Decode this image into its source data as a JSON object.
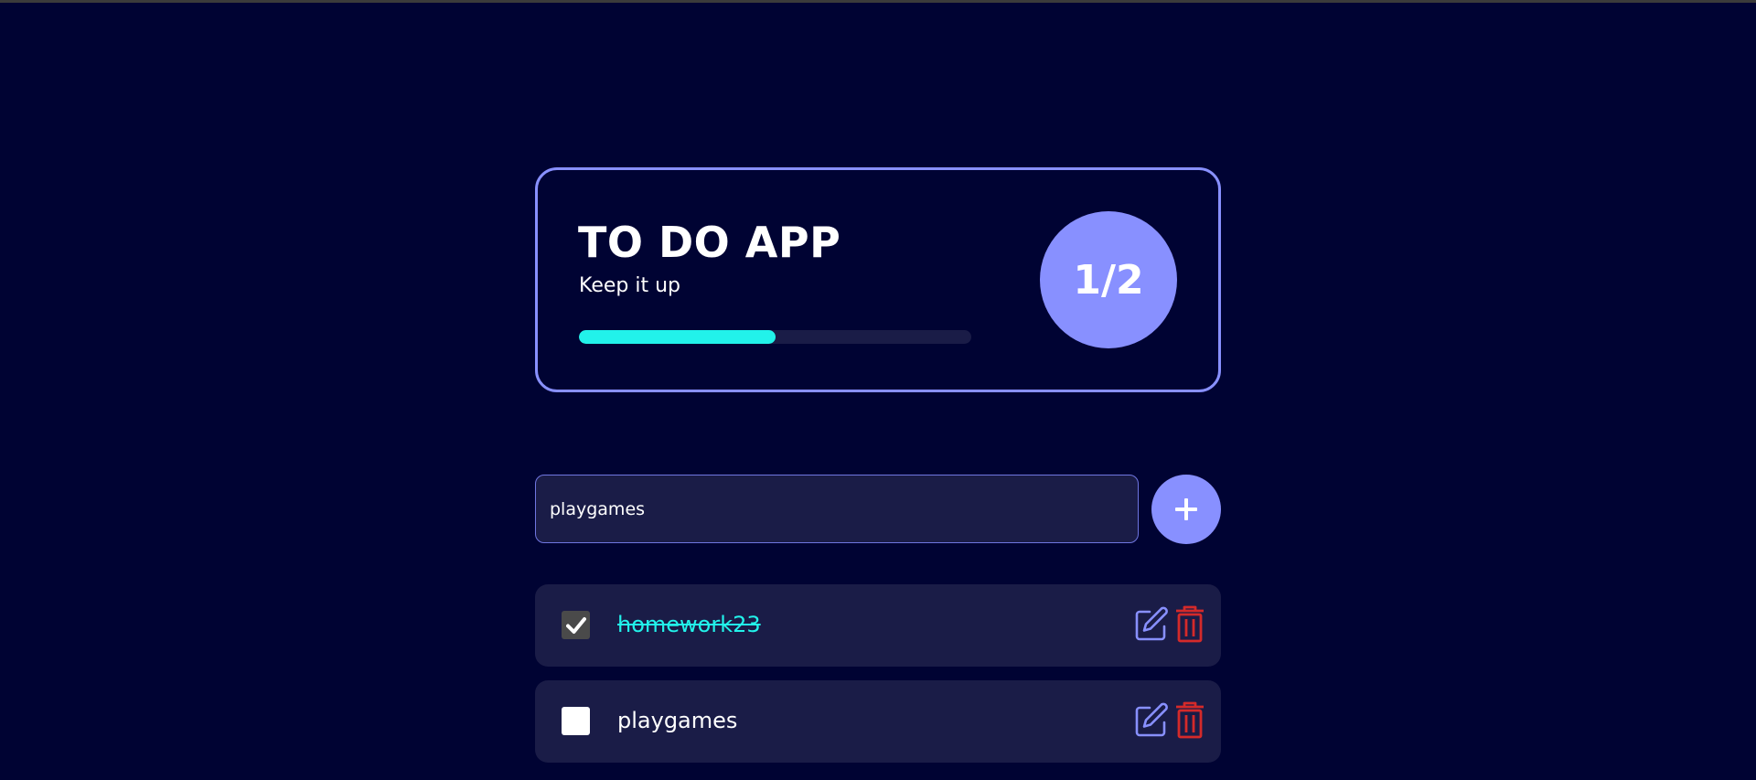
{
  "header": {
    "title": "TO DO APP",
    "subtitle": "Keep it up",
    "progress_percent": 50,
    "counter": "1/2"
  },
  "add_task": {
    "input_value": "playgames",
    "add_button_icon": "plus-icon"
  },
  "todos": [
    {
      "text": "homework23",
      "completed": true
    },
    {
      "text": "playgames",
      "completed": false
    }
  ],
  "icons": {
    "edit": "edit-icon",
    "delete": "trash-icon",
    "check": "checkmark-icon"
  },
  "colors": {
    "background": "#000333",
    "accent": "#8890ff",
    "progress": "#22f2ea",
    "card": "#1a1c47",
    "delete": "#d42a2a"
  }
}
